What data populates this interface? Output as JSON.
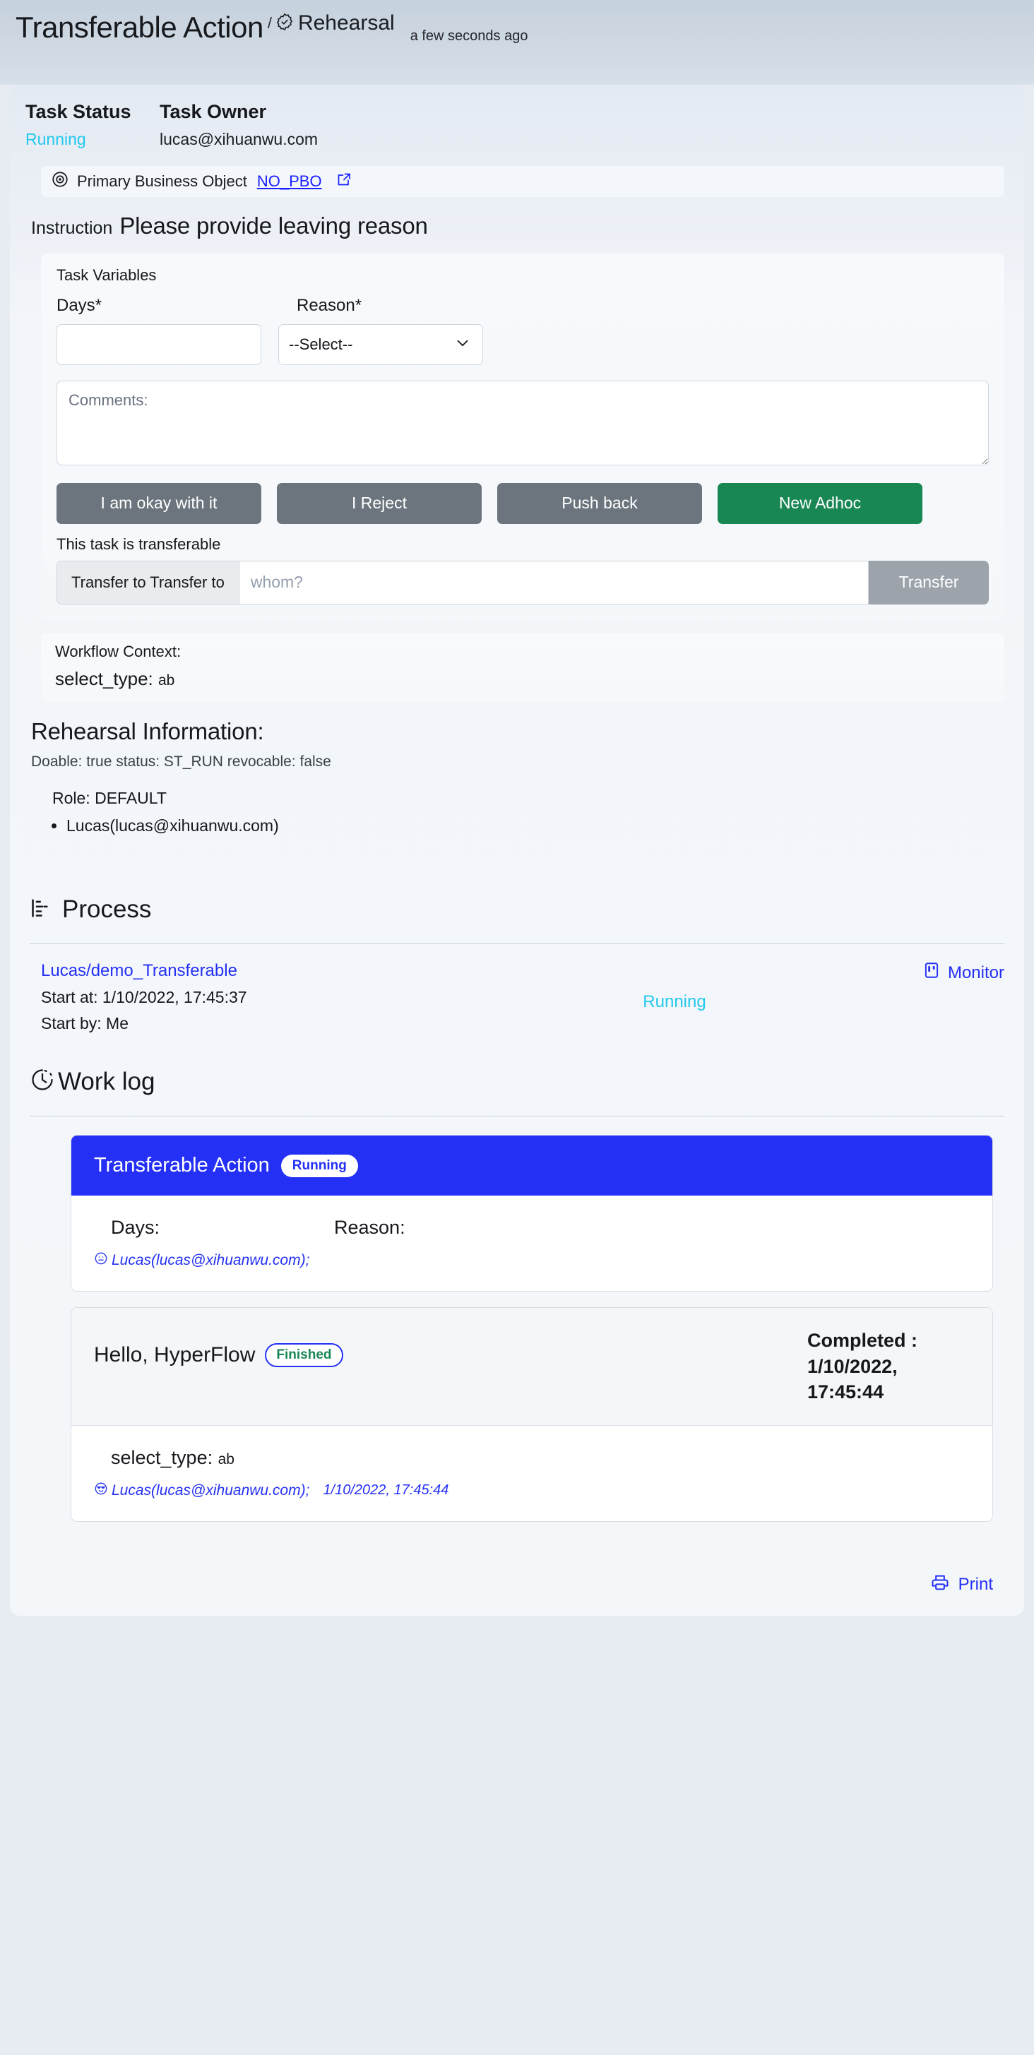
{
  "header": {
    "title": "Transferable Action",
    "separator": "/",
    "second_crumb": "Rehearsal",
    "seal_icon": "seal-check-icon",
    "time_ago": "a few seconds ago"
  },
  "status": {
    "task_status_label": "Task Status",
    "task_status_value": "Running",
    "task_owner_label": "Task Owner",
    "task_owner_value": "lucas@xihuanwu.com",
    "running_color": "#22c9ee"
  },
  "pbo": {
    "icon": "target-icon",
    "label": "Primary Business Object",
    "link_text": "NO_PBO",
    "external_icon": "external-link-icon"
  },
  "instruction": {
    "label": "Instruction",
    "text": "Please provide leaving reason"
  },
  "task_variables": {
    "title": "Task Variables",
    "days_label": "Days*",
    "days_value": "",
    "reason_label": "Reason*",
    "reason_selected": "--Select--",
    "comments_placeholder": "Comments:",
    "comments_value": "",
    "buttons": [
      {
        "label": "I am okay with it",
        "style": "gray"
      },
      {
        "label": "I Reject",
        "style": "gray"
      },
      {
        "label": "Push back",
        "style": "gray"
      },
      {
        "label": "New Adhoc",
        "style": "green"
      }
    ],
    "transferable_note": "This task is transferable",
    "transfer_addon": "Transfer to Transfer to",
    "transfer_placeholder": "whom?",
    "transfer_value": "",
    "transfer_button": "Transfer"
  },
  "workflow_context": {
    "title": "Workflow Context:",
    "key": "select_type:",
    "value": "ab"
  },
  "rehearsal": {
    "heading": "Rehearsal Information:",
    "summary": "Doable: true status: ST_RUN revocable: false",
    "role_line": "Role: DEFAULT",
    "members": [
      "Lucas(lucas@xihuanwu.com)"
    ]
  },
  "process": {
    "icon": "process-list-icon",
    "heading": "Process",
    "link": "Lucas/demo_Transferable",
    "start_at": "Start at: 1/10/2022, 17:45:37",
    "start_by": "Start by: Me",
    "state": "Running",
    "monitor_icon": "monitor-icon",
    "monitor_label": "Monitor"
  },
  "worklog": {
    "icon": "clock-icon",
    "heading": "Work log",
    "cards": [
      {
        "title": "Transferable Action",
        "badge": "Running",
        "badge_style": "running",
        "days_label": "Days:",
        "days_value": "",
        "reason_label": "Reason:",
        "reason_value": "",
        "actor_icon": "neutral-face-icon",
        "actor": "Lucas(lucas@xihuanwu.com);",
        "timestamp": ""
      },
      {
        "title": "Hello, HyperFlow",
        "badge": "Finished",
        "badge_style": "finished",
        "completed_label": "Completed :",
        "completed_value": "1/10/2022, 17:45:44",
        "key": "select_type:",
        "value": "ab",
        "actor_icon": "sunglasses-face-icon",
        "actor": "Lucas(lucas@xihuanwu.com);",
        "timestamp": "1/10/2022, 17:45:44"
      }
    ]
  },
  "footer": {
    "print_icon": "printer-icon",
    "print_label": "Print"
  }
}
